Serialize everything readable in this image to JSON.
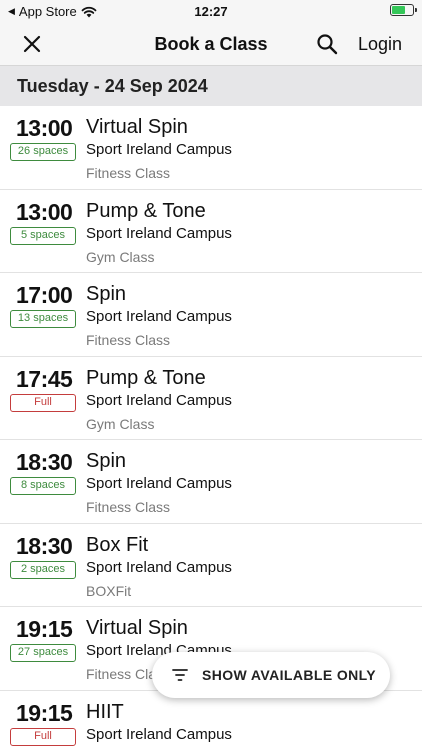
{
  "status_bar": {
    "carrier": "App Store",
    "time": "12:27"
  },
  "nav": {
    "title": "Book a Class",
    "login_label": "Login"
  },
  "date_header": "Tuesday - 24 Sep 2024",
  "classes": [
    {
      "time": "13:00",
      "spaces": "26 spaces",
      "full": false,
      "name": "Virtual Spin",
      "venue": "Sport Ireland Campus",
      "category": "Fitness Class"
    },
    {
      "time": "13:00",
      "spaces": "5 spaces",
      "full": false,
      "name": "Pump & Tone",
      "venue": "Sport Ireland Campus",
      "category": "Gym Class"
    },
    {
      "time": "17:00",
      "spaces": "13 spaces",
      "full": false,
      "name": "Spin",
      "venue": "Sport Ireland Campus",
      "category": "Fitness Class"
    },
    {
      "time": "17:45",
      "spaces": "Full",
      "full": true,
      "name": "Pump & Tone",
      "venue": "Sport Ireland Campus",
      "category": "Gym Class"
    },
    {
      "time": "18:30",
      "spaces": "8 spaces",
      "full": false,
      "name": "Spin",
      "venue": "Sport Ireland Campus",
      "category": "Fitness Class"
    },
    {
      "time": "18:30",
      "spaces": "2 spaces",
      "full": false,
      "name": "Box Fit",
      "venue": "Sport Ireland Campus",
      "category": "BOXFit"
    },
    {
      "time": "19:15",
      "spaces": "27 spaces",
      "full": false,
      "name": "Virtual Spin",
      "venue": "Sport Ireland Campus",
      "category": "Fitness Class"
    },
    {
      "time": "19:15",
      "spaces": "Full",
      "full": true,
      "name": "HIIT",
      "venue": "Sport Ireland Campus",
      "category": ""
    }
  ],
  "filter_button": {
    "label": "SHOW AVAILABLE ONLY"
  },
  "colors": {
    "available": "#3e8b3e",
    "full": "#c43d3d",
    "battery": "#35c759"
  },
  "icons": [
    "wifi-icon",
    "battery-icon",
    "close-icon",
    "search-icon",
    "filter-icon"
  ]
}
